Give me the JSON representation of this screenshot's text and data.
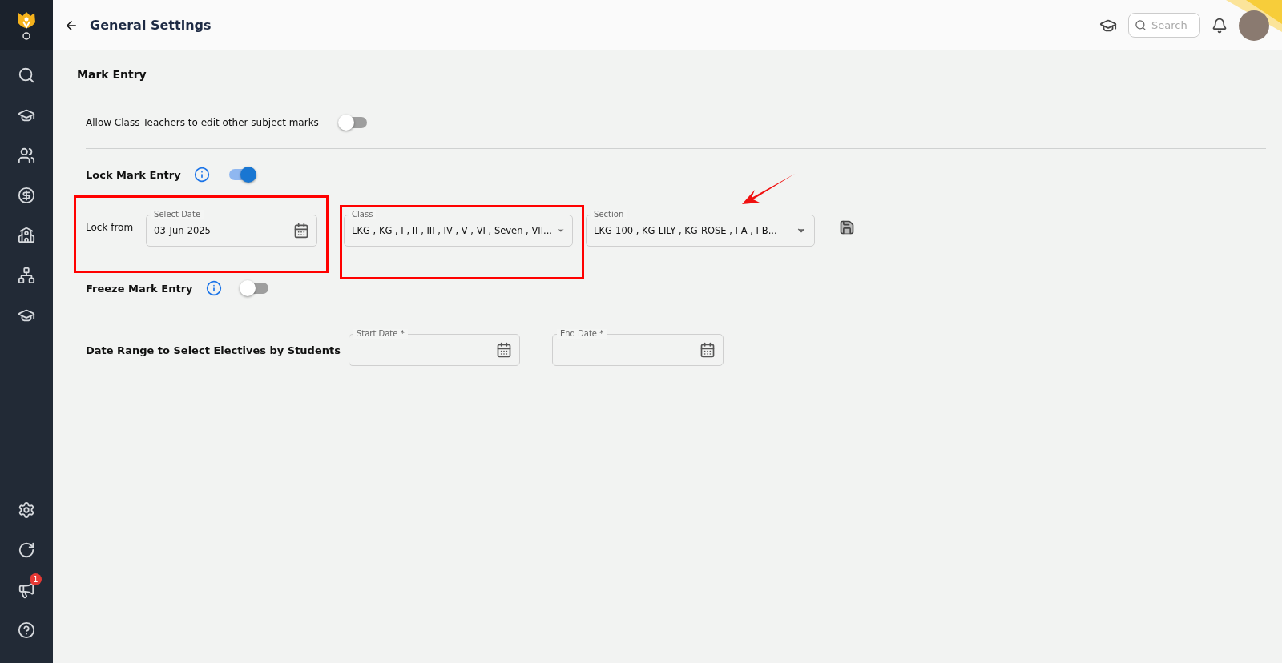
{
  "sidebar": {
    "notification_badge": "1"
  },
  "header": {
    "title": "General Settings",
    "search": {
      "placeholder": "Search"
    }
  },
  "section_title": "Mark Entry",
  "allow_edit": {
    "label": "Allow Class Teachers to edit other subject marks",
    "on": false
  },
  "lock": {
    "label": "Lock Mark Entry",
    "on": true,
    "from_label": "Lock from",
    "fields": [
      {
        "kind": "date",
        "label": "Select Date",
        "value": "03-Jun-2025"
      },
      {
        "kind": "select",
        "label": "Class",
        "value": "LKG , KG , I , II , III , IV , V , VI , Seven , VII..."
      },
      {
        "kind": "select",
        "label": "Section",
        "value": "LKG-100 , KG-LILY , KG-ROSE , I-A , I-B..."
      }
    ]
  },
  "freeze": {
    "label": "Freeze Mark Entry",
    "on": false
  },
  "electives": {
    "label": "Date Range to Select Electives by Students",
    "fields": [
      {
        "kind": "date",
        "label": "Start Date *"
      },
      {
        "kind": "date",
        "label": "End Date *"
      }
    ]
  }
}
